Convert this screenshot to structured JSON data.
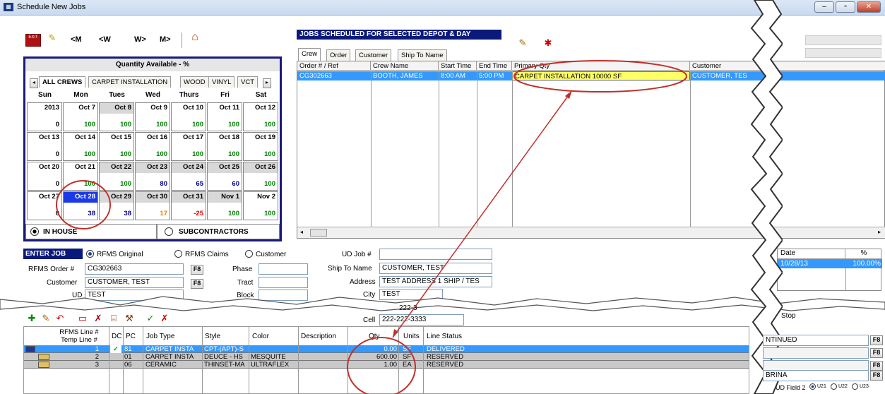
{
  "window": {
    "title": "Schedule New Jobs",
    "app_icon": "grid-icon"
  },
  "toolbar": {
    "exit_label": "EXIT",
    "nav": [
      "<M",
      "<W",
      "W>",
      "M>"
    ]
  },
  "calendar": {
    "header": "Quantity Available - %",
    "tabs": [
      "ALL CREWS",
      "CARPET INSTALLATION",
      "WOOD",
      "VINYL",
      "VCT"
    ],
    "days": [
      "Sun",
      "Mon",
      "Tues",
      "Wed",
      "Thurs",
      "Fri",
      "Sat"
    ],
    "weeks": [
      [
        {
          "d": "2013",
          "v": "0",
          "c": "#000"
        },
        {
          "d": "Oct 7",
          "v": "100",
          "c": "#008000"
        },
        {
          "d": "Oct 8",
          "v": "100",
          "c": "#008000",
          "g": true
        },
        {
          "d": "Oct 9",
          "v": "100",
          "c": "#008000"
        },
        {
          "d": "Oct 10",
          "v": "100",
          "c": "#008000"
        },
        {
          "d": "Oct 11",
          "v": "100",
          "c": "#008000"
        },
        {
          "d": "Oct 12",
          "v": "100",
          "c": "#008000"
        }
      ],
      [
        {
          "d": "Oct 13",
          "v": "0",
          "c": "#000"
        },
        {
          "d": "Oct 14",
          "v": "100",
          "c": "#008000"
        },
        {
          "d": "Oct 15",
          "v": "100",
          "c": "#008000"
        },
        {
          "d": "Oct 16",
          "v": "100",
          "c": "#008000"
        },
        {
          "d": "Oct 17",
          "v": "100",
          "c": "#008000"
        },
        {
          "d": "Oct 18",
          "v": "100",
          "c": "#008000"
        },
        {
          "d": "Oct 19",
          "v": "100",
          "c": "#008000"
        }
      ],
      [
        {
          "d": "Oct 20",
          "v": "0",
          "c": "#000"
        },
        {
          "d": "Oct 21",
          "v": "100",
          "c": "#008000"
        },
        {
          "d": "Oct 22",
          "v": "100",
          "c": "#008000",
          "g": true
        },
        {
          "d": "Oct 23",
          "v": "80",
          "c": "#00008b",
          "g": true
        },
        {
          "d": "Oct 24",
          "v": "65",
          "c": "#00008b",
          "g": true
        },
        {
          "d": "Oct 25",
          "v": "60",
          "c": "#00008b",
          "g": true
        },
        {
          "d": "Oct 26",
          "v": "100",
          "c": "#008000",
          "g": true
        }
      ],
      [
        {
          "d": "Oct 27",
          "v": "0",
          "c": "#000"
        },
        {
          "d": "Oct 28",
          "v": "38",
          "c": "#00008b",
          "sel": true
        },
        {
          "d": "Oct 29",
          "v": "38",
          "c": "#00008b",
          "g": true
        },
        {
          "d": "Oct 30",
          "v": "17",
          "c": "#e08000",
          "g": true
        },
        {
          "d": "Oct 31",
          "v": "-25",
          "c": "#e00000",
          "g": true
        },
        {
          "d": "Nov 1",
          "v": "100",
          "c": "#008000",
          "g": true
        },
        {
          "d": "Nov 2",
          "v": "100",
          "c": "#008000"
        }
      ]
    ],
    "in_house": "IN HOUSE",
    "subcontractors": "SUBCONTRACTORS"
  },
  "jobs": {
    "title": "JOBS SCHEDULED FOR SELECTED DEPOT & DAY",
    "tabs": [
      "Crew",
      "Order",
      "Customer",
      "Ship To Name"
    ],
    "columns": [
      "Order # / Ref",
      "Crew Name",
      "Start Time",
      "End Time",
      "Primary Qty",
      "Customer"
    ],
    "rows": [
      [
        "CG302663",
        "BOOTH, JAMES",
        "8:00 AM",
        "5:00 PM",
        "CARPET INSTALLATION 10000 SF",
        "CUSTOMER, TES"
      ]
    ]
  },
  "job_info": {
    "header": "ENTER JOB INFO",
    "radios": [
      "RFMS Original",
      "RFMS Claims",
      "Customer"
    ],
    "rfms_order_label": "RFMS Order #",
    "rfms_order": "CG302663",
    "customer_label": "Customer",
    "customer": "CUSTOMER, TEST",
    "ud_label": "UD",
    "ud": "TEST",
    "phase_label": "Phase",
    "tract_label": "Tract",
    "block_label": "Block",
    "f8": "F8"
  },
  "ship": {
    "ud_job_label": "UD Job #",
    "ship_to_label": "Ship To Name",
    "ship_to": "CUSTOMER, TEST",
    "address_label": "Address",
    "address": "TEST ADDRESS 1 SHIP / TES",
    "city_label": "City",
    "city": "TEST",
    "phone_partial": "222-3",
    "cell_label": "Cell",
    "cell": "222-222-3333"
  },
  "side": {
    "date_header": "Date",
    "pct_header": "%",
    "date": "10/28/13",
    "pct": "100.00%",
    "stop": "Stop",
    "continued": "NTINUED",
    "sabrina": "BRINA",
    "ud_field": "UD Field 2",
    "radios": [
      "U21",
      "U22",
      "U23"
    ]
  },
  "lines": {
    "columns": [
      "RFMS Line #\nTemp Line #",
      "DC",
      "PC",
      "Job Type",
      "Style",
      "Color",
      "Description",
      "Qty",
      "Units",
      "Line Status"
    ],
    "rows": [
      {
        "line": "1",
        "dc": "✓",
        "pc": "81",
        "type": "CARPET INSTA",
        "style": "CPT-(APT)-S",
        "color": "",
        "desc": "",
        "qty": "0.00",
        "units": "SF",
        "status": "DELIVERED"
      },
      {
        "line": "2",
        "dc": "",
        "pc": "01",
        "type": "CARPET INSTA",
        "style": "DEUCE - HS",
        "color": "MESQUITE",
        "desc": "",
        "qty": "600.00",
        "units": "SF",
        "status": "RESERVED"
      },
      {
        "line": "3",
        "dc": "",
        "pc": "06",
        "type": "CERAMIC",
        "style": "THINSET-MA",
        "color": "ULTRAFLEX",
        "desc": "",
        "qty": "1.00",
        "units": "EA",
        "status": "RESERVED"
      }
    ]
  },
  "colors": {
    "selection": "#3399ff",
    "highlight_yellow": "#ffff66",
    "annotation": "#c0302a",
    "calendar_border": "#1a1a7a"
  }
}
